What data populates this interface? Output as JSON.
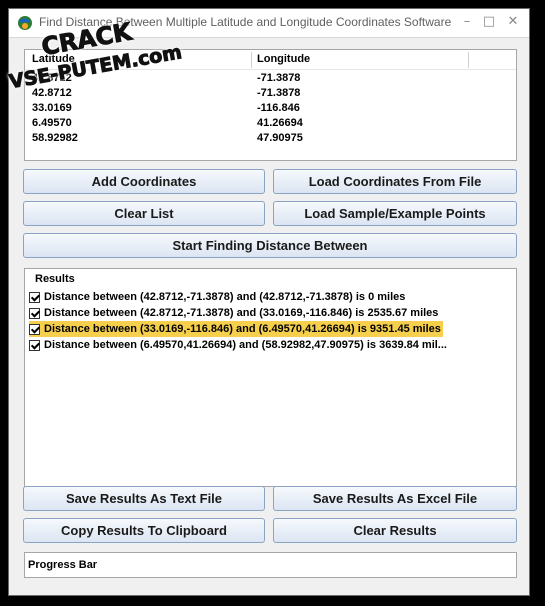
{
  "window": {
    "title": "Find Distance Between Multiple Latitude and Longitude Coordinates Software",
    "minimize": "–",
    "maximize": "□",
    "close": "✕"
  },
  "coordinates": {
    "headers": [
      "Latitude",
      "Longitude"
    ],
    "rows": [
      [
        "42.8712",
        "-71.3878"
      ],
      [
        "42.8712",
        "-71.3878"
      ],
      [
        "33.0169",
        "-116.846"
      ],
      [
        "6.49570",
        "41.26694"
      ],
      [
        "58.92982",
        "47.90975"
      ]
    ]
  },
  "buttons": {
    "add_coordinates": "Add Coordinates",
    "load_from_file": "Load Coordinates From File",
    "clear_list": "Clear List",
    "load_sample": "Load Sample/Example Points",
    "start": "Start Finding Distance Between",
    "save_text": "Save Results As Text File",
    "save_excel": "Save Results As Excel File",
    "copy_clipboard": "Copy Results To Clipboard",
    "clear_results": "Clear Results"
  },
  "results": {
    "header": "Results",
    "rows": [
      {
        "text": "Distance between (42.8712,-71.3878) and (42.8712,-71.3878) is 0 miles",
        "checked": true,
        "selected": false
      },
      {
        "text": "Distance between (42.8712,-71.3878) and (33.0169,-116.846) is 2535.67 miles",
        "checked": true,
        "selected": false
      },
      {
        "text": "Distance between (33.0169,-116.846) and (6.49570,41.26694) is 9351.45 miles",
        "checked": true,
        "selected": true
      },
      {
        "text": "Distance between (6.49570,41.26694) and (58.92982,47.90975) is 3639.84 mil...",
        "checked": true,
        "selected": false
      }
    ]
  },
  "progress": {
    "label": "Progress Bar"
  },
  "watermark": {
    "line1": "CRACK",
    "line2": "VSE-PUTEM.com"
  },
  "colors": {
    "selection": "#f6d04d",
    "button_border": "#8ca4c4",
    "window_bg": "#f0f0f0"
  },
  "icons": [
    "app-globe-icon",
    "checkbox-checked-icon"
  ]
}
